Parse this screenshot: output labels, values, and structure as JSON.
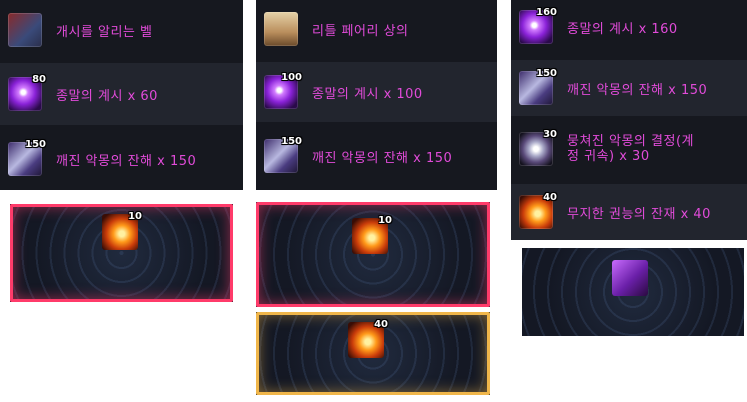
{
  "panel_a": {
    "rows": [
      {
        "icon": "red-book-icon",
        "count": "",
        "label": "개시를 알리는 벨"
      },
      {
        "icon": "purple-orb-icon",
        "count": "80",
        "label": "종말의 계시 x 60"
      },
      {
        "icon": "feather-relic-icon",
        "count": "150",
        "label": "깨진 악몽의 잔해 x 150"
      }
    ]
  },
  "panel_b": {
    "rows": [
      {
        "icon": "tan-shirt-icon",
        "count": "",
        "label": "리틀 페어리 상의"
      },
      {
        "icon": "purple-orb-icon",
        "count": "100",
        "label": "종말의 계시 x 100"
      },
      {
        "icon": "feather-relic-icon",
        "count": "150",
        "label": "깨진 악몽의 잔해 x 150"
      }
    ]
  },
  "panel_c": {
    "rows": [
      {
        "icon": "purple-orb-icon",
        "count": "160",
        "label": "종말의 계시 x 160"
      },
      {
        "icon": "feather-relic-icon",
        "count": "150",
        "label": "깨진 악몽의 잔해 x 150"
      },
      {
        "icon": "crystal-shard-icon",
        "count": "30",
        "label": "뭉쳐진 악몽의 결정(계정 귀속) x 30"
      },
      {
        "icon": "flame-swirl-icon",
        "count": "40",
        "label": "무지한 권능의 잔재 x 40"
      }
    ]
  },
  "slot_1": {
    "count": "10",
    "icon": "flame-swirl-icon",
    "frame_color": "#ff3b6a"
  },
  "slot_2": {
    "count": "10",
    "icon": "flame-swirl-icon",
    "frame_color": "#ff3b6a"
  },
  "slot_3": {
    "count": "40",
    "icon": "flame-swirl-icon",
    "frame_color": "#f0b64a"
  },
  "slot_4": {
    "count": "",
    "icon": "purple-chest-icon"
  },
  "colors": {
    "label": "#e14bd9",
    "panel_bg": "#16181f",
    "row_alt_bg": "#22252e"
  }
}
